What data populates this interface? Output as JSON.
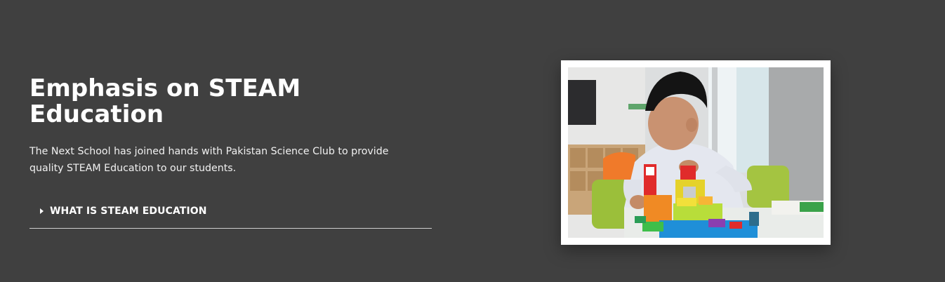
{
  "section": {
    "title": "Emphasis on STEAM Education",
    "description": "The Next School has joined hands with Pakistan Science Club to provide quality STEAM Education to our students.",
    "accordion": {
      "label": "WHAT IS STEAM EDUCATION",
      "icon": "caret-right-icon",
      "expanded": false
    },
    "image": {
      "alt": "Child building with colorful toy blocks"
    }
  },
  "colors": {
    "background": "#404040",
    "text": "#ffffff",
    "divider": "#cfcfcf",
    "frame": "#ffffff"
  }
}
